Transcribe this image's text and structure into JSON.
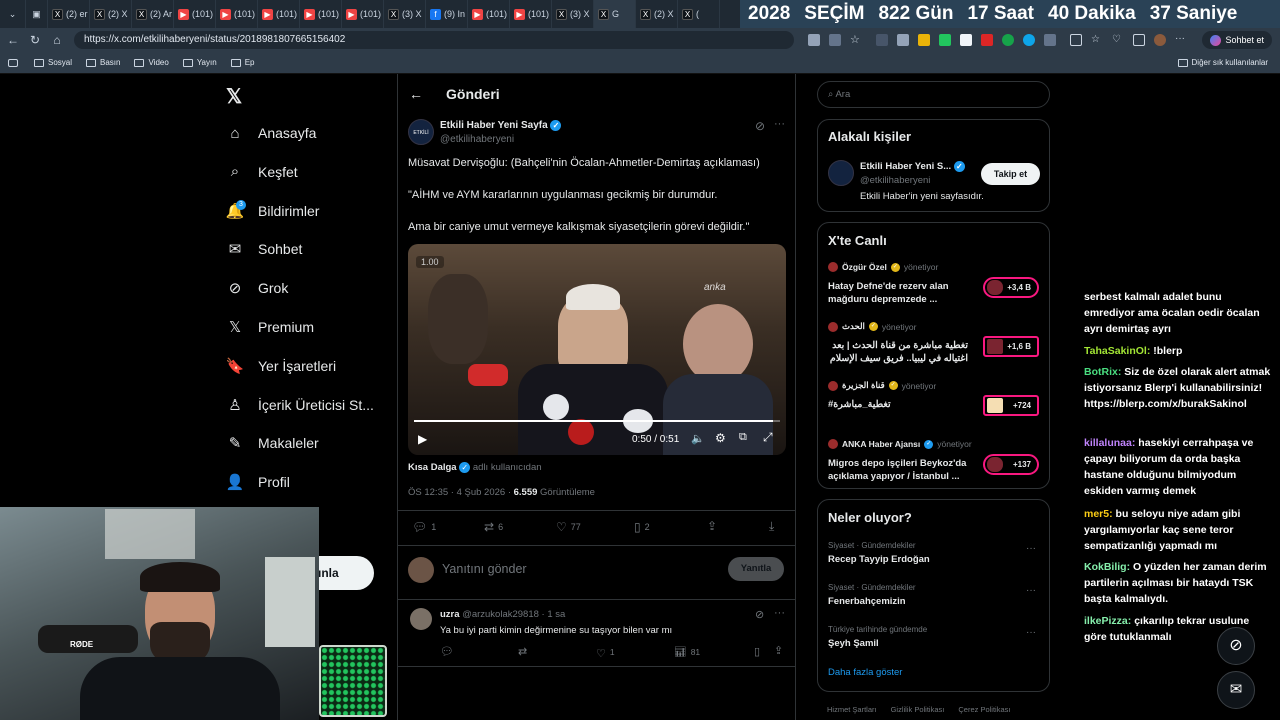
{
  "browser": {
    "tabs": [
      {
        "label": "(2) er",
        "icon": "x-icon"
      },
      {
        "label": "(2) X",
        "icon": "x-icon"
      },
      {
        "label": "(2) Ar",
        "icon": "x-icon"
      },
      {
        "label": "(101)",
        "icon": "youtube-icon"
      },
      {
        "label": "(101)",
        "icon": "youtube-icon"
      },
      {
        "label": "(101)",
        "icon": "youtube-icon"
      },
      {
        "label": "(101)",
        "icon": "youtube-icon"
      },
      {
        "label": "(101)",
        "icon": "youtube-icon"
      },
      {
        "label": "(3) X",
        "icon": "x-icon"
      },
      {
        "label": "(9) In",
        "icon": "facebook-icon"
      },
      {
        "label": "(101)",
        "icon": "youtube-icon"
      },
      {
        "label": "(101)",
        "icon": "youtube-icon"
      },
      {
        "label": "(3) X",
        "icon": "x-icon"
      },
      {
        "label": "G",
        "icon": "x-icon"
      },
      {
        "label": "(2) X",
        "icon": "x-icon"
      },
      {
        "label": "(",
        "icon": "x-icon"
      }
    ],
    "countdown": {
      "year": "2028",
      "label": "SEÇİM",
      "days": "822 Gün",
      "hours": "17 Saat",
      "minutes": "40 Dakika",
      "seconds": "37 Saniye"
    },
    "url": "https://x.com/etkilihaberyeni/status/2018981807665156402",
    "sohbet_label": "Sohbet et",
    "bookmarks": [
      "Sosyal",
      "Basın",
      "Video",
      "Yayın",
      "Ep"
    ],
    "bookmarks_right": "Diğer sık kullanılanlar"
  },
  "nav": {
    "items": [
      {
        "label": "Anasayfa",
        "icon": "home-icon",
        "glyph": "⌂"
      },
      {
        "label": "Keşfet",
        "icon": "search-icon",
        "glyph": "⌕"
      },
      {
        "label": "Bildirimler",
        "icon": "bell-icon",
        "glyph": "🔔"
      },
      {
        "label": "Sohbet",
        "icon": "mail-icon",
        "glyph": "✉"
      },
      {
        "label": "Grok",
        "icon": "grok-icon",
        "glyph": "⊘"
      },
      {
        "label": "Premium",
        "icon": "x-logo-icon",
        "glyph": "𝕏"
      },
      {
        "label": "Yer İşaretleri",
        "icon": "bookmark-icon",
        "glyph": "🔖"
      },
      {
        "label": "İçerik Üreticisi St...",
        "icon": "creator-studio-icon",
        "glyph": "♙"
      },
      {
        "label": "Makaleler",
        "icon": "articles-icon",
        "glyph": "✎"
      },
      {
        "label": "Profil",
        "icon": "person-icon",
        "glyph": "👤"
      }
    ],
    "notification_badge": "3",
    "post_button_partial": "ınla"
  },
  "post": {
    "header_title": "Gönderi",
    "author_name": "Etkili Haber Yeni Sayfa",
    "author_handle": "@etkilihaberyeni",
    "avatar_text": "ETKİLİ HABER",
    "text1": "Müsavat Dervişoğlu: (Bahçeli'nin Öcalan-Ahmetler-Demirtaş açıklaması)",
    "text2": "\"AİHM ve AYM kararlarının uygulanması gecikmiş bir durumdur.",
    "text3": "Ama bir caniye umut vermeye kalkışmak siyasetçilerin görevi değildir.\"",
    "video": {
      "speed": "1.00",
      "watermark": "anka",
      "time": "0:50 / 0:51",
      "progress": 0.98
    },
    "source_name": "Kısa Dalga",
    "source_suffix": "adlı kullanıcıdan",
    "timestamp": "ÖS 12:35 · 4 Şub 2026 · ",
    "views_count": "6.559",
    "views_label": " Görüntüleme",
    "actions": {
      "replies": "1",
      "reposts": "6",
      "likes": "77",
      "bookmarks": "2"
    },
    "reply_placeholder": "Yanıtını gönder",
    "reply_button": "Yanıtla"
  },
  "reply": {
    "name": "uzra",
    "handle_time": "@arzukolak29818 · 1 sa",
    "text": "Ya bu iyi parti kimin değirmenine su taşıyor bilen var mı",
    "replies": "",
    "likes": "1",
    "views": "81"
  },
  "right": {
    "search_placeholder": "Ara",
    "people_title": "Alakalı kişiler",
    "person_name": "Etkili Haber Yeni S...",
    "person_handle": "@etkilihaberyeni",
    "person_bio": "Etkili Haber'in yeni sayfasıdır.",
    "follow_label": "Takip et",
    "live_title": "X'te Canlı",
    "live": [
      {
        "host": "Özgür Özel",
        "status": "yönetiyor",
        "text": "Hatay Defne'de rezerv alan mağduru depremzede ...",
        "count": "+3,4 B",
        "badge": "gold"
      },
      {
        "host": "الحدث",
        "status": "yönetiyor",
        "text": "تغطية مباشرة من قناة الحدث | بعد اغتياله في ليبيا.. فريق سيف الإسلام",
        "count": "+1,6 B",
        "badge": "gold"
      },
      {
        "host": "قناة الجزيرة",
        "status": "yönetiyor",
        "text": "#تغطية_مباشرة",
        "count": "+724",
        "badge": "gold"
      },
      {
        "host": "ANKA Haber Ajansı",
        "status": "yönetiyor",
        "text": "Migros depo işçileri Beykoz'da açıklama yapıyor / İstanbul ...",
        "count": "+137",
        "badge": "blue"
      }
    ],
    "trends_title": "Neler oluyor?",
    "trends": [
      {
        "meta": "Siyaset · Gündemdekiler",
        "name": "Recep Tayyip Erdoğan"
      },
      {
        "meta": "Siyaset · Gündemdekiler",
        "name": "Fenerbahçemizin"
      },
      {
        "meta": "Türkiye tarihinde gündemde",
        "name": "Şeyh Şamil"
      }
    ],
    "show_more": "Daha fazla göster",
    "footer": [
      "Hizmet Şartları",
      "Gizlilik Politikası",
      "Çerez Politikası"
    ]
  },
  "chat": [
    {
      "user": "",
      "color": "#ffffff",
      "text": "serbest kalmalı adalet bunu emrediyor ama öcalan oedir öcalan ayrı demirtaş ayrı"
    },
    {
      "user": "TahaSakinOl:",
      "color": "#a3e635",
      "text": "!blerp"
    },
    {
      "user": "BotRix:",
      "color": "#4ade80",
      "text": "Siz de özel olarak alert atmak istiyorsanız Blerp'i kullanabilirsiniz! https://blerp.com/x/burakSakinol"
    },
    {
      "user": "killalunaa:",
      "color": "#c084fc",
      "text": "hasekiyi cerrahpaşa ve çapayı biliyorum da orda başka hastane olduğunu bilmiyodum eskiden varmış demek"
    },
    {
      "user": "mer5:",
      "color": "#facc15",
      "text": "bu seloyu niye adam gibi yargılamıyorlar kaç sene teror sempatizanlığı yapmadı mı"
    },
    {
      "user": "KokBilig:",
      "color": "#86efac",
      "text": "O yüzden her zaman derim partilerin açılması bir hataydı TSK başta kalmalıydı."
    },
    {
      "user": "ilkePizza:",
      "color": "#86efac",
      "text": "çıkarılıp tekrar usulune göre tutuklanmalı"
    }
  ],
  "webcam": {
    "mic_label": "RØDE"
  }
}
